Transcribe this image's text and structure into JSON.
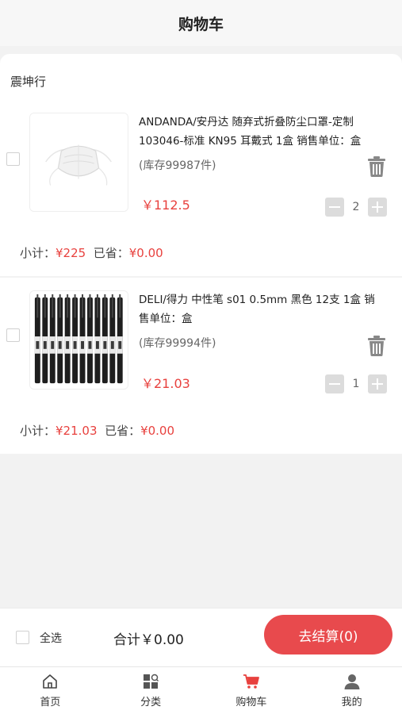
{
  "header": {
    "title": "购物车"
  },
  "store": {
    "name": "震坤行"
  },
  "items": [
    {
      "title": "ANDANDA/安丹达 随弃式折叠防尘口罩-定制103046-标准 KN95 耳戴式 1盒 销售单位：盒",
      "stock": "(库存99987件)",
      "price": "￥112.5",
      "quantity": "2",
      "subtotal_label": "小计：",
      "subtotal_value": "¥225",
      "saved_label": "已省：",
      "saved_value": "¥0.00",
      "image_icon": "face-mask-image"
    },
    {
      "title": "DELI/得力 中性笔 s01 0.5mm 黑色 12支 1盒 销售单位：盒",
      "stock": "(库存99994件)",
      "price": "￥21.03",
      "quantity": "1",
      "subtotal_label": "小计：",
      "subtotal_value": "¥21.03",
      "saved_label": "已省：",
      "saved_value": "¥0.00",
      "image_icon": "pens-image"
    }
  ],
  "checkout": {
    "select_all_label": "全选",
    "total_text": "合计￥0.00",
    "button_label": "去结算(0)"
  },
  "tabbar": [
    {
      "label": "首页",
      "icon": "home-icon"
    },
    {
      "label": "分类",
      "icon": "category-icon"
    },
    {
      "label": "购物车",
      "icon": "cart-icon"
    },
    {
      "label": "我的",
      "icon": "user-icon"
    }
  ],
  "colors": {
    "accent": "#e8413e",
    "checkout_button": "#e84a4d",
    "cart_active": "#e8413e"
  }
}
